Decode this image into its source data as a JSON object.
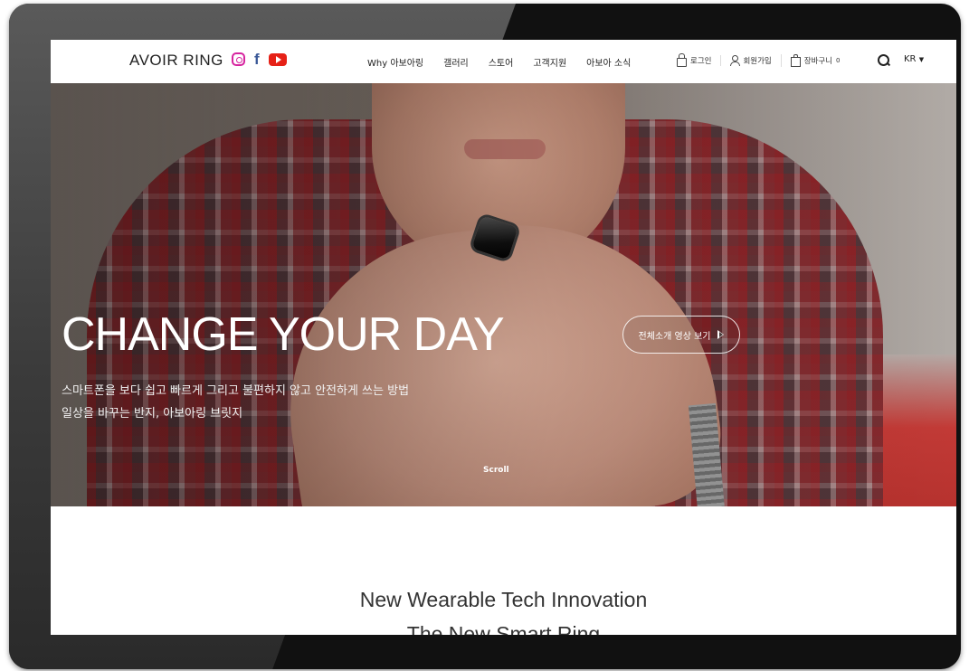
{
  "header": {
    "logo": "AVOIR RING",
    "social": [
      "instagram-icon",
      "facebook-icon",
      "youtube-icon"
    ],
    "nav": [
      "Why 아보아링",
      "갤러리",
      "스토어",
      "고객지원",
      "아보아 소식"
    ],
    "util": {
      "login": "로그인",
      "signup": "회원가입",
      "cart": "장바구니",
      "cart_count": "0"
    },
    "lang": "KR"
  },
  "hero": {
    "headline": "CHANGE YOUR DAY",
    "subline1": "스마트폰을 보다 쉽고 빠르게 그리고 불편하지 않고 안전하게 쓰는 방법",
    "subline2": "일상을 바꾸는 반지, 아보아링 브릿지",
    "video_button": "전체소개 영상 보기",
    "scroll": "Scroll"
  },
  "section": {
    "title": "New Wearable Tech Innovation",
    "subtitle": "The New Smart Ring"
  },
  "colors": {
    "instagram": "#d6249f",
    "facebook": "#3b5998",
    "youtube": "#e62117",
    "device_frame": "#111111"
  }
}
